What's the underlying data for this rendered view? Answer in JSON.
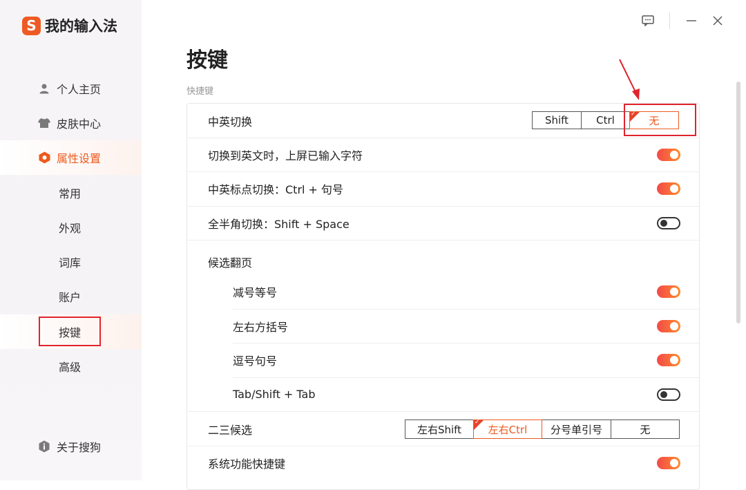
{
  "app": {
    "logo_char": "S",
    "title": "我的输入法"
  },
  "sidebar": {
    "items": [
      {
        "label": "个人主页",
        "icon": "user-icon"
      },
      {
        "label": "皮肤中心",
        "icon": "shirt-icon"
      },
      {
        "label": "属性设置",
        "icon": "hexagon-settings-icon"
      }
    ],
    "sub_items": [
      "常用",
      "外观",
      "词库",
      "账户",
      "按键",
      "高级"
    ],
    "selected_sub": "按键",
    "about": "关于搜狗"
  },
  "window": {
    "controls": [
      "feedback-icon",
      "minimize-icon",
      "close-icon"
    ]
  },
  "page": {
    "title": "按键",
    "section": "快捷键",
    "rows": {
      "cn_en_switch": {
        "label": "中英切换",
        "options": [
          "Shift",
          "Ctrl",
          "无"
        ],
        "selected": "无"
      },
      "commit_on_switch": {
        "label": "切换到英文时，上屏已输入字符",
        "on": true
      },
      "punct_switch": {
        "label": "中英标点切换：Ctrl + 句号",
        "on": true
      },
      "fullhalf_switch": {
        "label": "全半角切换：Shift + Space",
        "on": false
      },
      "paging_header": {
        "label": "候选翻页"
      },
      "minus_equal": {
        "label": "减号等号",
        "on": true
      },
      "brackets": {
        "label": "左右方括号",
        "on": true
      },
      "comma_period": {
        "label": "逗号句号",
        "on": true
      },
      "tab_shift_tab": {
        "label": "Tab/Shift + Tab",
        "on": false
      },
      "second_third": {
        "label": "二三候选",
        "options": [
          "左右Shift",
          "左右Ctrl",
          "分号单引号",
          "无"
        ],
        "selected": "左右Ctrl"
      },
      "system_shortcuts": {
        "label": "系统功能快捷键",
        "on": true
      }
    }
  },
  "accent_color": "#ec5a1e",
  "highlight_color": "#e0232d"
}
